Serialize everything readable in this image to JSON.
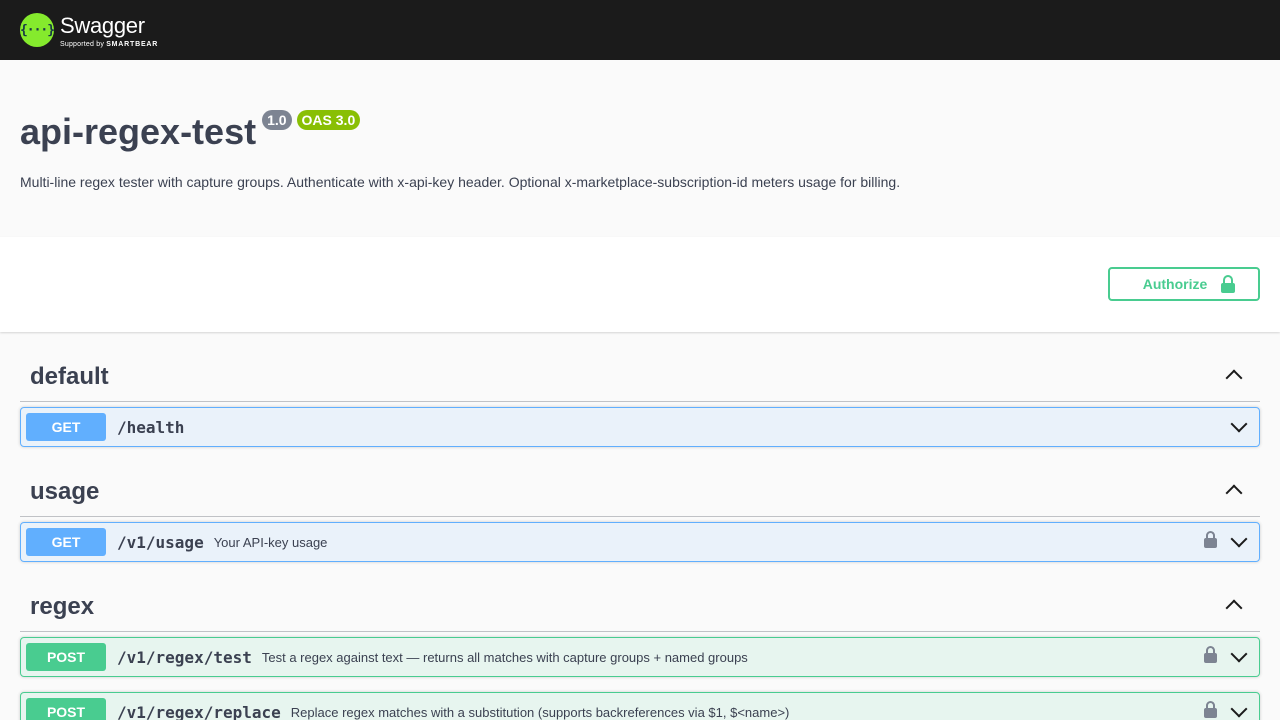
{
  "topbar": {
    "logo_symbol": "{···}",
    "logo_title": "Swagger",
    "logo_sub_prefix": "Supported by",
    "logo_sub_brand": "SMARTBEAR"
  },
  "info": {
    "title": "api-regex-test",
    "version": "1.0",
    "oas": "OAS 3.0",
    "description": "Multi-line regex tester with capture groups. Authenticate with x-api-key header. Optional x-marketplace-subscription-id meters usage for billing."
  },
  "auth": {
    "label": "Authorize"
  },
  "tags": [
    {
      "name": "default",
      "ops": [
        {
          "method": "GET",
          "path": "/health",
          "summary": "",
          "locked": false
        }
      ]
    },
    {
      "name": "usage",
      "ops": [
        {
          "method": "GET",
          "path": "/v1/usage",
          "summary": "Your API-key usage",
          "locked": true
        }
      ]
    },
    {
      "name": "regex",
      "ops": [
        {
          "method": "POST",
          "path": "/v1/regex/test",
          "summary": "Test a regex against text — returns all matches with capture groups + named groups",
          "locked": true
        },
        {
          "method": "POST",
          "path": "/v1/regex/replace",
          "summary": "Replace regex matches with a substitution (supports backreferences via $1, $<name>)",
          "locked": true
        }
      ]
    }
  ],
  "colors": {
    "get": "#61affe",
    "post": "#49cc90",
    "topbar": "#1b1b1b",
    "logo": "#85ea2d"
  }
}
